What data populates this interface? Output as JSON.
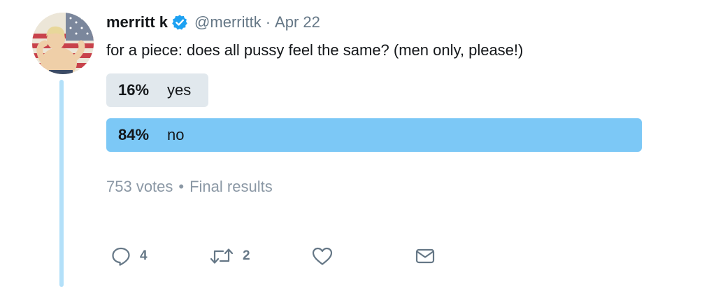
{
  "tweet": {
    "display_name": "merritt k",
    "handle": "@merrittk",
    "separator": "·",
    "date": "Apr 22",
    "text": "for a piece: does all pussy feel the same? (men only, please!)",
    "verified": true,
    "icons": {
      "verified": "verified-badge-icon",
      "reply": "reply-icon",
      "retweet": "retweet-icon",
      "like": "like-heart-icon",
      "dm": "direct-message-icon"
    }
  },
  "poll": {
    "options": [
      {
        "percent": "16%",
        "label": "yes",
        "share": 0.16,
        "leader": false
      },
      {
        "percent": "84%",
        "label": "no",
        "share": 0.84,
        "leader": true
      }
    ],
    "votes": "753 votes",
    "meta_separator": "•",
    "status": "Final results",
    "colors": {
      "leader": "#7cc8f6",
      "other": "#e1e8ed"
    }
  },
  "actions": {
    "reply_count": "4",
    "retweet_count": "2"
  },
  "colors": {
    "thread_line": "#b3e0f9",
    "verified": "#1da1f2",
    "secondary_text": "#657786",
    "muted_text": "#8b98a5"
  }
}
